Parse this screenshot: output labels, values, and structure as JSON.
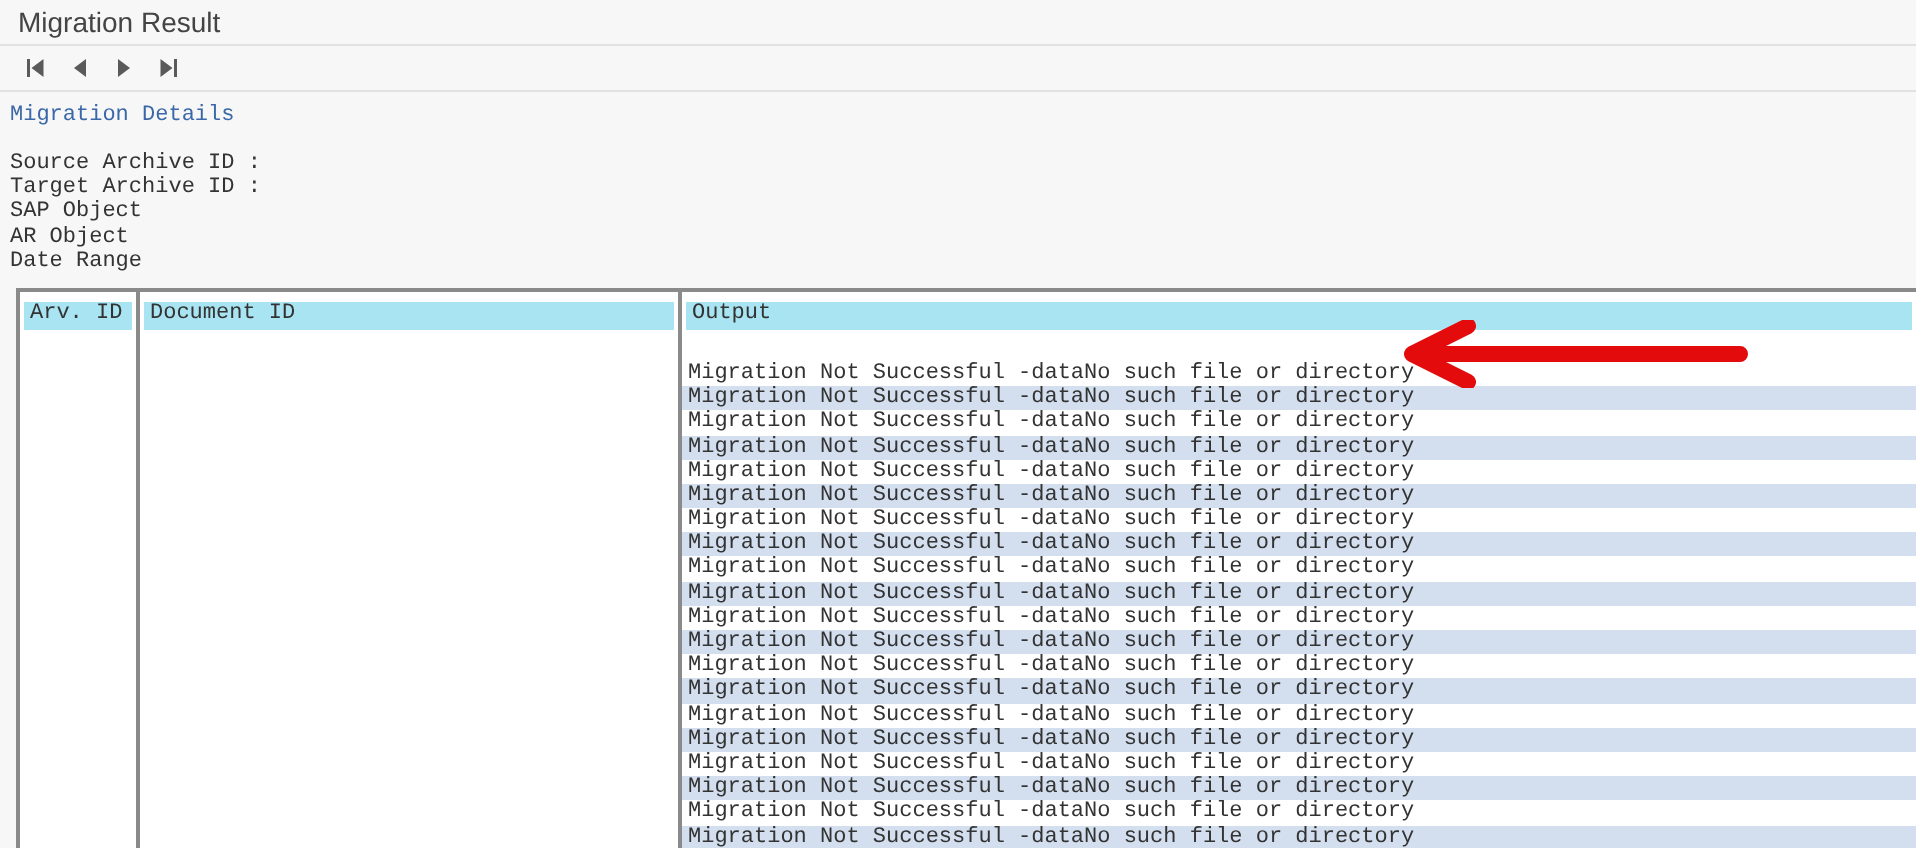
{
  "window": {
    "title": "Migration Result"
  },
  "toolbar": [
    {
      "kind": "first"
    },
    {
      "kind": "prev"
    },
    {
      "kind": "next"
    },
    {
      "kind": "last"
    }
  ],
  "details": {
    "heading": "Migration Details",
    "fields": [
      {
        "label": "Source Archive ID :"
      },
      {
        "label": "Target Archive ID :"
      },
      {
        "label": "SAP Object"
      },
      {
        "label": "AR Object"
      },
      {
        "label": "Date Range"
      }
    ]
  },
  "table": {
    "columns": [
      "Arv. ID",
      "Document ID",
      "Output"
    ],
    "rows": [
      "Migration Not Successful -dataNo such file or directory",
      "Migration Not Successful -dataNo such file or directory",
      "Migration Not Successful -dataNo such file or directory",
      "Migration Not Successful -dataNo such file or directory",
      "Migration Not Successful -dataNo such file or directory",
      "Migration Not Successful -dataNo such file or directory",
      "Migration Not Successful -dataNo such file or directory",
      "Migration Not Successful -dataNo such file or directory",
      "Migration Not Successful -dataNo such file or directory",
      "Migration Not Successful -dataNo such file or directory",
      "Migration Not Successful -dataNo such file or directory",
      "Migration Not Successful -dataNo such file or directory",
      "Migration Not Successful -dataNo such file or directory",
      "Migration Not Successful -dataNo such file or directory",
      "Migration Not Successful -dataNo such file or directory",
      "Migration Not Successful -dataNo such file or directory",
      "Migration Not Successful -dataNo such file or directory",
      "Migration Not Successful -dataNo such file or directory",
      "Migration Not Successful -dataNo such file or directory",
      "Migration Not Successful -dataNo such file or directory"
    ]
  }
}
